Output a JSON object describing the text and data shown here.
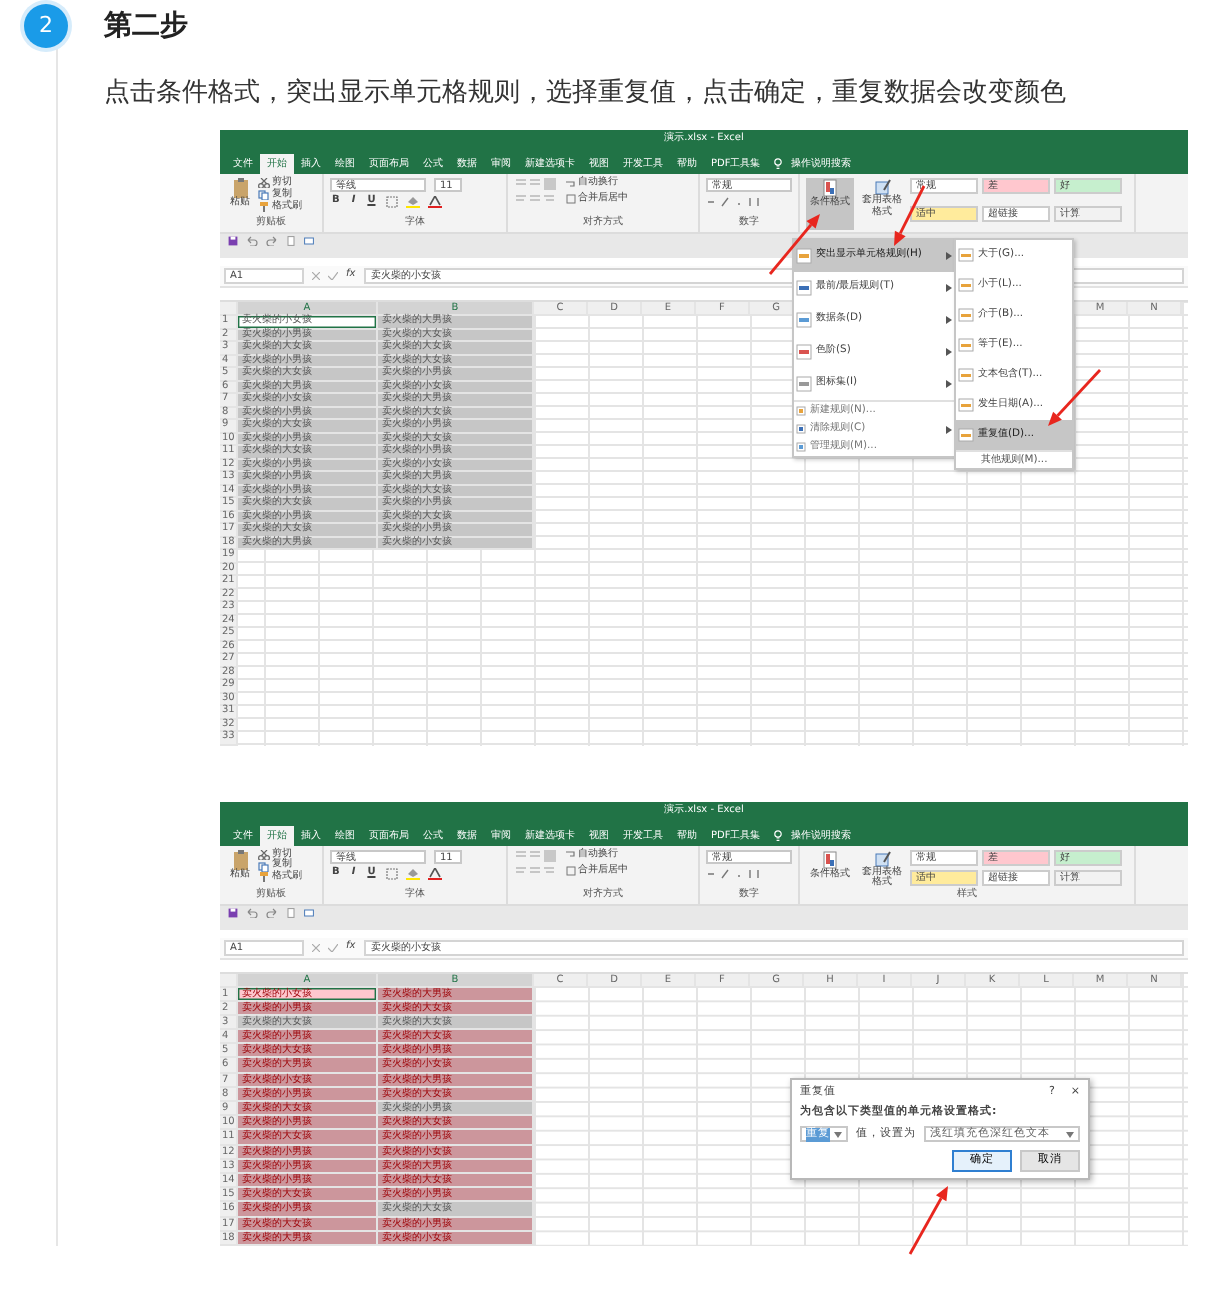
{
  "step": {
    "number": "2",
    "title": "第二步"
  },
  "instruction": "点击条件格式，突出显示单元格规则，选择重复值，点击确定，重复数据会改变颜色",
  "screenshots": [
    {
      "window_title": "演示.xlsx  -  Excel",
      "ribbon_tabs": [
        {
          "label": "文件",
          "selected": false
        },
        {
          "label": "开始",
          "selected": true
        },
        {
          "label": "插入",
          "selected": false
        },
        {
          "label": "绘图",
          "selected": false
        },
        {
          "label": "页面布局",
          "selected": false
        },
        {
          "label": "公式",
          "selected": false
        },
        {
          "label": "数据",
          "selected": false
        },
        {
          "label": "审阅",
          "selected": false
        },
        {
          "label": "新建选项卡",
          "selected": false
        },
        {
          "label": "视图",
          "selected": false
        },
        {
          "label": "开发工具",
          "selected": false
        },
        {
          "label": "帮助",
          "selected": false
        },
        {
          "label": "PDF工具集",
          "selected": false
        }
      ],
      "search_hint": "操作说明搜索",
      "ribbon": {
        "clipboard": {
          "paste": "粘贴",
          "cut": "剪切",
          "copy": "复制",
          "format_painter": "格式刷",
          "group": "剪贴板"
        },
        "font": {
          "name": "等线",
          "size": "11",
          "buttons": [
            "B",
            "I",
            "U"
          ],
          "group": "字体"
        },
        "alignment": {
          "wrap": "自动换行",
          "merge": "合并后居中",
          "group": "对齐方式"
        },
        "number": {
          "format": "常规",
          "group": "数字"
        },
        "styles": {
          "conditional": "条件格式",
          "conditional_pressed": true,
          "table": "套用表格格式",
          "cells": [
            {
              "label": "常规",
              "color": "#ffffff"
            },
            {
              "label": "差",
              "color": "#ffc7ce"
            },
            {
              "label": "好",
              "color": "#c6efce"
            },
            {
              "label": "适中",
              "color": "#ffeb9c"
            },
            {
              "label": "超链接",
              "color": "#ffffff"
            },
            {
              "label": "计算",
              "color": "#f2f2f2"
            }
          ]
        }
      },
      "name_box": "A1",
      "function_label": "fx",
      "formula": "卖火柴的小女孩",
      "columns": [
        "A",
        "B",
        "C",
        "D",
        "E",
        "F",
        "G"
      ],
      "trailing_columns": [
        "M",
        "N"
      ],
      "rows": [
        {
          "number": "1",
          "cells": [
            {
              "text": "卖火柴的小女孩",
              "selected": true,
              "active": true,
              "duplicate": false
            },
            {
              "text": "卖火柴的大男孩",
              "selected": true,
              "active": false,
              "duplicate": false
            }
          ]
        },
        {
          "number": "2",
          "cells": [
            {
              "text": "卖火柴的小男孩",
              "selected": true,
              "active": false,
              "duplicate": false
            },
            {
              "text": "卖火柴的大女孩",
              "selected": true,
              "active": false,
              "duplicate": false
            }
          ]
        },
        {
          "number": "3",
          "cells": [
            {
              "text": "卖火柴的大女孩",
              "selected": true,
              "active": false,
              "duplicate": false
            },
            {
              "text": "卖火柴的大女孩",
              "selected": true,
              "active": false,
              "duplicate": false
            }
          ]
        },
        {
          "number": "4",
          "cells": [
            {
              "text": "卖火柴的小男孩",
              "selected": true,
              "active": false,
              "duplicate": false
            },
            {
              "text": "卖火柴的大女孩",
              "selected": true,
              "active": false,
              "duplicate": false
            }
          ]
        },
        {
          "number": "5",
          "cells": [
            {
              "text": "卖火柴的大女孩",
              "selected": true,
              "active": false,
              "duplicate": false
            },
            {
              "text": "卖火柴的小男孩",
              "selected": true,
              "active": false,
              "duplicate": false
            }
          ]
        },
        {
          "number": "6",
          "cells": [
            {
              "text": "卖火柴的大男孩",
              "selected": true,
              "active": false,
              "duplicate": false
            },
            {
              "text": "卖火柴的小女孩",
              "selected": true,
              "active": false,
              "duplicate": false
            }
          ]
        },
        {
          "number": "7",
          "cells": [
            {
              "text": "卖火柴的小女孩",
              "selected": true,
              "active": false,
              "duplicate": false
            },
            {
              "text": "卖火柴的大男孩",
              "selected": true,
              "active": false,
              "duplicate": false
            }
          ]
        },
        {
          "number": "8",
          "cells": [
            {
              "text": "卖火柴的小男孩",
              "selected": true,
              "active": false,
              "duplicate": false
            },
            {
              "text": "卖火柴的大女孩",
              "selected": true,
              "active": false,
              "duplicate": false
            }
          ]
        },
        {
          "number": "9",
          "cells": [
            {
              "text": "卖火柴的大女孩",
              "selected": true,
              "active": false,
              "duplicate": false
            },
            {
              "text": "卖火柴的小男孩",
              "selected": true,
              "active": false,
              "duplicate": false
            }
          ]
        },
        {
          "number": "10",
          "cells": [
            {
              "text": "卖火柴的小男孩",
              "selected": true,
              "active": false,
              "duplicate": false
            },
            {
              "text": "卖火柴的大女孩",
              "selected": true,
              "active": false,
              "duplicate": false
            }
          ]
        },
        {
          "number": "11",
          "cells": [
            {
              "text": "卖火柴的大女孩",
              "selected": true,
              "active": false,
              "duplicate": false
            },
            {
              "text": "卖火柴的小男孩",
              "selected": true,
              "active": false,
              "duplicate": false
            }
          ]
        },
        {
          "number": "12",
          "cells": [
            {
              "text": "卖火柴的小男孩",
              "selected": true,
              "active": false,
              "duplicate": false
            },
            {
              "text": "卖火柴的小女孩",
              "selected": true,
              "active": false,
              "duplicate": false
            }
          ]
        },
        {
          "number": "13",
          "cells": [
            {
              "text": "卖火柴的小男孩",
              "selected": true,
              "active": false,
              "duplicate": false
            },
            {
              "text": "卖火柴的大男孩",
              "selected": true,
              "active": false,
              "duplicate": false
            }
          ]
        },
        {
          "number": "14",
          "cells": [
            {
              "text": "卖火柴的小男孩",
              "selected": true,
              "active": false,
              "duplicate": false
            },
            {
              "text": "卖火柴的大女孩",
              "selected": true,
              "active": false,
              "duplicate": false
            }
          ]
        },
        {
          "number": "15",
          "cells": [
            {
              "text": "卖火柴的大女孩",
              "selected": true,
              "active": false,
              "duplicate": false
            },
            {
              "text": "卖火柴的小男孩",
              "selected": true,
              "active": false,
              "duplicate": false
            }
          ]
        },
        {
          "number": "16",
          "cells": [
            {
              "text": "卖火柴的小男孩",
              "selected": true,
              "active": false,
              "duplicate": false
            },
            {
              "text": "卖火柴的大女孩",
              "selected": true,
              "active": false,
              "duplicate": false
            }
          ]
        },
        {
          "number": "17",
          "cells": [
            {
              "text": "卖火柴的大女孩",
              "selected": true,
              "active": false,
              "duplicate": false
            },
            {
              "text": "卖火柴的小男孩",
              "selected": true,
              "active": false,
              "duplicate": false
            }
          ]
        },
        {
          "number": "18",
          "cells": [
            {
              "text": "卖火柴的大男孩",
              "selected": true,
              "active": false,
              "duplicate": false
            },
            {
              "text": "卖火柴的小女孩",
              "selected": true,
              "active": false,
              "duplicate": false
            }
          ]
        }
      ],
      "blank_rows": [
        "19",
        "20",
        "21",
        "22",
        "23",
        "24",
        "25",
        "26",
        "27",
        "28",
        "29",
        "30",
        "31",
        "32",
        "33"
      ],
      "overlay": {
        "kind": "conditional_menu",
        "items": [
          {
            "label": "突出显示单元格规则(H)",
            "kind": "large",
            "has_submenu": true,
            "selected": true
          },
          {
            "label": "最前/最后规则(T)",
            "kind": "large",
            "has_submenu": true,
            "selected": false
          },
          {
            "label": "数据条(D)",
            "kind": "large",
            "has_submenu": true,
            "selected": false
          },
          {
            "label": "色阶(S)",
            "kind": "large",
            "has_submenu": true,
            "selected": false
          },
          {
            "label": "图标集(I)",
            "kind": "large",
            "has_submenu": true,
            "selected": false
          },
          {
            "label": "新建规则(N)...",
            "kind": "small",
            "has_submenu": false,
            "selected": false
          },
          {
            "label": "清除规则(C)",
            "kind": "small",
            "has_submenu": true,
            "selected": false
          },
          {
            "label": "管理规则(M)...",
            "kind": "small",
            "has_submenu": false,
            "selected": false
          }
        ],
        "submenu": [
          {
            "label": "大于(G)...",
            "selected": false
          },
          {
            "label": "小于(L)...",
            "selected": false
          },
          {
            "label": "介于(B)...",
            "selected": false
          },
          {
            "label": "等于(E)...",
            "selected": false
          },
          {
            "label": "文本包含(T)...",
            "selected": false
          },
          {
            "label": "发生日期(A)...",
            "selected": false
          },
          {
            "label": "重复值(D)...",
            "selected": true
          }
        ],
        "submenu_footer": "其他规则(M)..."
      }
    },
    {
      "window_title": "演示.xlsx  -  Excel",
      "ribbon_tabs": [
        {
          "label": "文件",
          "selected": false
        },
        {
          "label": "开始",
          "selected": true
        },
        {
          "label": "插入",
          "selected": false
        },
        {
          "label": "绘图",
          "selected": false
        },
        {
          "label": "页面布局",
          "selected": false
        },
        {
          "label": "公式",
          "selected": false
        },
        {
          "label": "数据",
          "selected": false
        },
        {
          "label": "审阅",
          "selected": false
        },
        {
          "label": "新建选项卡",
          "selected": false
        },
        {
          "label": "视图",
          "selected": false
        },
        {
          "label": "开发工具",
          "selected": false
        },
        {
          "label": "帮助",
          "selected": false
        },
        {
          "label": "PDF工具集",
          "selected": false
        }
      ],
      "search_hint": "操作说明搜索",
      "ribbon": {
        "clipboard": {
          "paste": "粘贴",
          "cut": "剪切",
          "copy": "复制",
          "format_painter": "格式刷",
          "group": "剪贴板"
        },
        "font": {
          "name": "等线",
          "size": "11",
          "buttons": [
            "B",
            "I",
            "U"
          ],
          "group": "字体"
        },
        "alignment": {
          "wrap": "自动换行",
          "merge": "合并后居中",
          "group": "对齐方式"
        },
        "number": {
          "format": "常规",
          "group": "数字"
        },
        "styles": {
          "conditional": "条件格式",
          "conditional_pressed": false,
          "table": "套用表格格式",
          "cells": [
            {
              "label": "常规",
              "color": "#ffffff"
            },
            {
              "label": "差",
              "color": "#ffc7ce"
            },
            {
              "label": "好",
              "color": "#c6efce"
            },
            {
              "label": "适中",
              "color": "#ffeb9c"
            },
            {
              "label": "超链接",
              "color": "#ffffff"
            },
            {
              "label": "计算",
              "color": "#f2f2f2"
            }
          ],
          "group": "样式"
        }
      },
      "name_box": "A1",
      "function_label": "fx",
      "formula": "卖火柴的小女孩",
      "columns": [
        "A",
        "B",
        "C",
        "D",
        "E",
        "F",
        "G",
        "H",
        "I",
        "J",
        "K",
        "L",
        "M",
        "N"
      ],
      "rows": [
        {
          "number": "1",
          "cells": [
            {
              "text": "卖火柴的小女孩",
              "selected": true,
              "active": true,
              "duplicate": true
            },
            {
              "text": "卖火柴的大男孩",
              "selected": true,
              "active": false,
              "duplicate": true
            }
          ]
        },
        {
          "number": "2",
          "cells": [
            {
              "text": "卖火柴的小男孩",
              "selected": true,
              "active": false,
              "duplicate": true
            },
            {
              "text": "卖火柴的大女孩",
              "selected": true,
              "active": false,
              "duplicate": true
            }
          ]
        },
        {
          "number": "3",
          "cells": [
            {
              "text": "卖火柴的大女孩",
              "selected": true,
              "active": false,
              "duplicate": false
            },
            {
              "text": "卖火柴的大女孩",
              "selected": true,
              "active": false,
              "duplicate": false
            }
          ]
        },
        {
          "number": "4",
          "cells": [
            {
              "text": "卖火柴的小男孩",
              "selected": true,
              "active": false,
              "duplicate": true
            },
            {
              "text": "卖火柴的大女孩",
              "selected": true,
              "active": false,
              "duplicate": true
            }
          ]
        },
        {
          "number": "5",
          "cells": [
            {
              "text": "卖火柴的大女孩",
              "selected": true,
              "active": false,
              "duplicate": true
            },
            {
              "text": "卖火柴的小男孩",
              "selected": true,
              "active": false,
              "duplicate": true
            }
          ]
        },
        {
          "number": "6",
          "cells": [
            {
              "text": "卖火柴的大男孩",
              "selected": true,
              "active": false,
              "duplicate": true
            },
            {
              "text": "卖火柴的小女孩",
              "selected": true,
              "active": false,
              "duplicate": true
            }
          ]
        },
        {
          "number": "7",
          "cells": [
            {
              "text": "卖火柴的小女孩",
              "selected": true,
              "active": false,
              "duplicate": true
            },
            {
              "text": "卖火柴的大男孩",
              "selected": true,
              "active": false,
              "duplicate": true
            }
          ]
        },
        {
          "number": "8",
          "cells": [
            {
              "text": "卖火柴的小男孩",
              "selected": true,
              "active": false,
              "duplicate": true
            },
            {
              "text": "卖火柴的大女孩",
              "selected": true,
              "active": false,
              "duplicate": true
            }
          ]
        },
        {
          "number": "9",
          "cells": [
            {
              "text": "卖火柴的大女孩",
              "selected": true,
              "active": false,
              "duplicate": true
            },
            {
              "text": "卖火柴的小男孩",
              "selected": true,
              "active": false,
              "duplicate": false
            }
          ]
        },
        {
          "number": "10",
          "cells": [
            {
              "text": "卖火柴的小男孩",
              "selected": true,
              "active": false,
              "duplicate": true
            },
            {
              "text": "卖火柴的大女孩",
              "selected": true,
              "active": false,
              "duplicate": true
            }
          ]
        },
        {
          "number": "11",
          "cells": [
            {
              "text": "卖火柴的大女孩",
              "selected": true,
              "active": false,
              "duplicate": true
            },
            {
              "text": "卖火柴的小男孩",
              "selected": true,
              "active": false,
              "duplicate": true
            }
          ]
        },
        {
          "number": "12",
          "cells": [
            {
              "text": "卖火柴的小男孩",
              "selected": true,
              "active": false,
              "duplicate": true
            },
            {
              "text": "卖火柴的小女孩",
              "selected": true,
              "active": false,
              "duplicate": true
            }
          ]
        },
        {
          "number": "13",
          "cells": [
            {
              "text": "卖火柴的小男孩",
              "selected": true,
              "active": false,
              "duplicate": true
            },
            {
              "text": "卖火柴的大男孩",
              "selected": true,
              "active": false,
              "duplicate": true
            }
          ]
        },
        {
          "number": "14",
          "cells": [
            {
              "text": "卖火柴的小男孩",
              "selected": true,
              "active": false,
              "duplicate": true
            },
            {
              "text": "卖火柴的大女孩",
              "selected": true,
              "active": false,
              "duplicate": true
            }
          ]
        },
        {
          "number": "15",
          "cells": [
            {
              "text": "卖火柴的大女孩",
              "selected": true,
              "active": false,
              "duplicate": true
            },
            {
              "text": "卖火柴的小男孩",
              "selected": true,
              "active": false,
              "duplicate": true
            }
          ]
        },
        {
          "number": "16",
          "cells": [
            {
              "text": "卖火柴的小男孩",
              "selected": true,
              "active": false,
              "duplicate": true
            },
            {
              "text": "卖火柴的大女孩",
              "selected": true,
              "active": false,
              "duplicate": false
            }
          ]
        },
        {
          "number": "17",
          "cells": [
            {
              "text": "卖火柴的大女孩",
              "selected": true,
              "active": false,
              "duplicate": true
            },
            {
              "text": "卖火柴的小男孩",
              "selected": true,
              "active": false,
              "duplicate": true
            }
          ]
        },
        {
          "number": "18",
          "cells": [
            {
              "text": "卖火柴的大男孩",
              "selected": true,
              "active": false,
              "duplicate": true
            },
            {
              "text": "卖火柴的小女孩",
              "selected": true,
              "active": false,
              "duplicate": true
            }
          ]
        }
      ],
      "overlay": {
        "kind": "dialog",
        "title": "重复值",
        "help": "?",
        "close": "×",
        "prompt": "为包含以下类型值的单元格设置格式:",
        "type_value": "重复",
        "mid_label": "值，设置为",
        "format_value": "浅红填充色深红色文本",
        "buttons": [
          {
            "label": "确定",
            "focused": true
          },
          {
            "label": "取消",
            "focused": false
          }
        ]
      }
    }
  ]
}
